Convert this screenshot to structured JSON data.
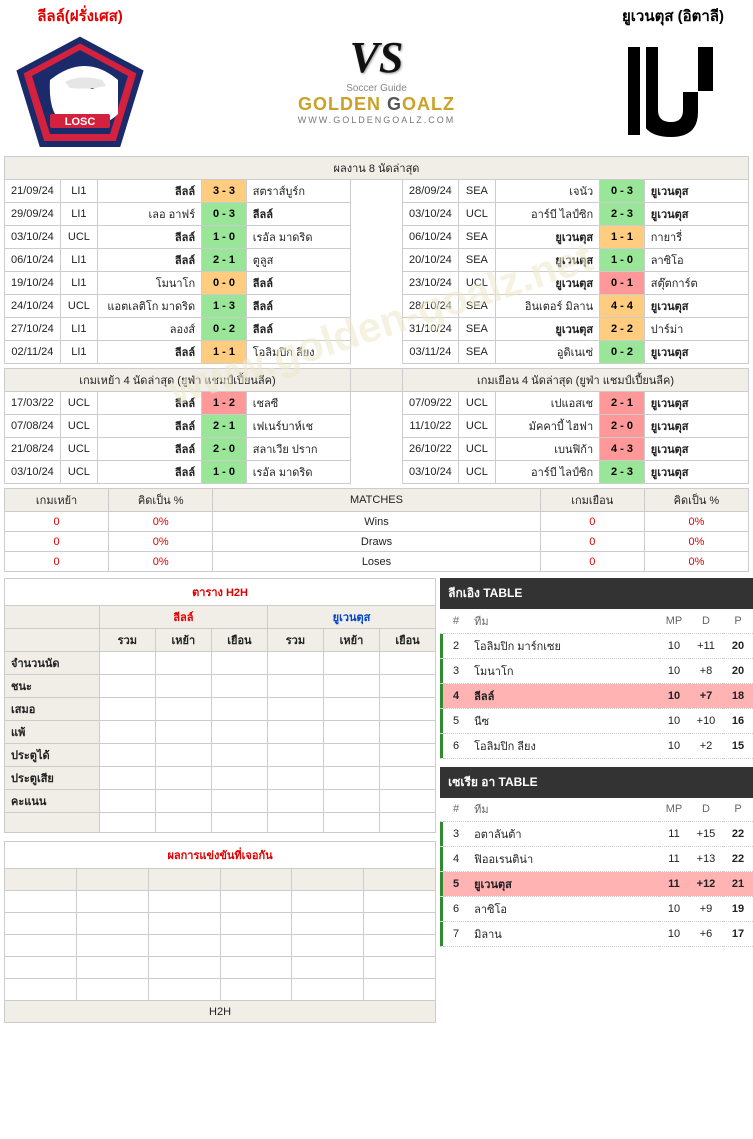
{
  "header": {
    "home_name": "ลีลล์(ฝรั่งเศส)",
    "away_name": "ยูเวนตุส (อิตาลี)",
    "vs": "VS",
    "site_brand_a": "GOLDEN",
    "site_brand_b": " G",
    "site_brand_c": "OALZ",
    "site_sub": "WWW.GOLDENGOALZ.COM",
    "soccer_guide": "Soccer Guide"
  },
  "last8": {
    "title": "ผลงาน 8 นัดล่าสุด",
    "home": [
      {
        "date": "21/09/24",
        "comp": "LI1",
        "home": "ลีลล์",
        "score": "3 - 3",
        "res": "draw",
        "away": "สตราส์บูร์ก",
        "focus": "home"
      },
      {
        "date": "29/09/24",
        "comp": "LI1",
        "home": "เลอ อาฟร์",
        "score": "0 - 3",
        "res": "win",
        "away": "ลีลล์",
        "focus": "away"
      },
      {
        "date": "03/10/24",
        "comp": "UCL",
        "home": "ลีลล์",
        "score": "1 - 0",
        "res": "win",
        "away": "เรอัล มาดริด",
        "focus": "home"
      },
      {
        "date": "06/10/24",
        "comp": "LI1",
        "home": "ลีลล์",
        "score": "2 - 1",
        "res": "win",
        "away": "ตูลูส",
        "focus": "home"
      },
      {
        "date": "19/10/24",
        "comp": "LI1",
        "home": "โมนาโก",
        "score": "0 - 0",
        "res": "draw",
        "away": "ลีลล์",
        "focus": "away"
      },
      {
        "date": "24/10/24",
        "comp": "UCL",
        "home": "แอตเลติโก มาดริด",
        "score": "1 - 3",
        "res": "win",
        "away": "ลีลล์",
        "focus": "away"
      },
      {
        "date": "27/10/24",
        "comp": "LI1",
        "home": "ลองส์",
        "score": "0 - 2",
        "res": "win",
        "away": "ลีลล์",
        "focus": "away"
      },
      {
        "date": "02/11/24",
        "comp": "LI1",
        "home": "ลีลล์",
        "score": "1 - 1",
        "res": "draw",
        "away": "โอลิมปิก ลียง",
        "focus": "home"
      }
    ],
    "away": [
      {
        "date": "28/09/24",
        "comp": "SEA",
        "home": "เจนัว",
        "score": "0 - 3",
        "res": "win",
        "away": "ยูเวนตุส",
        "focus": "away"
      },
      {
        "date": "03/10/24",
        "comp": "UCL",
        "home": "อาร์บี ไลป์ซิก",
        "score": "2 - 3",
        "res": "win",
        "away": "ยูเวนตุส",
        "focus": "away"
      },
      {
        "date": "06/10/24",
        "comp": "SEA",
        "home": "ยูเวนตุส",
        "score": "1 - 1",
        "res": "draw",
        "away": "กายารี่",
        "focus": "home"
      },
      {
        "date": "20/10/24",
        "comp": "SEA",
        "home": "ยูเวนตุส",
        "score": "1 - 0",
        "res": "win",
        "away": "ลาซิโอ",
        "focus": "home"
      },
      {
        "date": "23/10/24",
        "comp": "UCL",
        "home": "ยูเวนตุส",
        "score": "0 - 1",
        "res": "loss",
        "away": "สตุ๊ตการ์ต",
        "focus": "home"
      },
      {
        "date": "28/10/24",
        "comp": "SEA",
        "home": "อินเตอร์ มิลาน",
        "score": "4 - 4",
        "res": "draw",
        "away": "ยูเวนตุส",
        "focus": "away"
      },
      {
        "date": "31/10/24",
        "comp": "SEA",
        "home": "ยูเวนตุส",
        "score": "2 - 2",
        "res": "draw",
        "away": "ปาร์ม่า",
        "focus": "home"
      },
      {
        "date": "03/11/24",
        "comp": "SEA",
        "home": "อูดิเนเซ่",
        "score": "0 - 2",
        "res": "win",
        "away": "ยูเวนตุส",
        "focus": "away"
      }
    ]
  },
  "last4": {
    "home_title": "เกมเหย้า 4 นัดล่าสุด (ยูฟ่า แชมป์เปี้ยนลีค)",
    "away_title": "เกมเยือน 4 นัดล่าสุด (ยูฟ่า แชมป์เปี้ยนลีค)",
    "home": [
      {
        "date": "17/03/22",
        "comp": "UCL",
        "home": "ลีลล์",
        "score": "1 - 2",
        "res": "loss",
        "away": "เชลซี"
      },
      {
        "date": "07/08/24",
        "comp": "UCL",
        "home": "ลีลล์",
        "score": "2 - 1",
        "res": "win",
        "away": "เฟเนร์บาห์เช"
      },
      {
        "date": "21/08/24",
        "comp": "UCL",
        "home": "ลีลล์",
        "score": "2 - 0",
        "res": "win",
        "away": "สลาเวีย ปราก"
      },
      {
        "date": "03/10/24",
        "comp": "UCL",
        "home": "ลีลล์",
        "score": "1 - 0",
        "res": "win",
        "away": "เรอัล มาดริด"
      }
    ],
    "away": [
      {
        "date": "07/09/22",
        "comp": "UCL",
        "home": "เปแอสเช",
        "score": "2 - 1",
        "res": "loss",
        "away": "ยูเวนตุส"
      },
      {
        "date": "11/10/22",
        "comp": "UCL",
        "home": "มัคคาบี้ ไฮฟา",
        "score": "2 - 0",
        "res": "loss",
        "away": "ยูเวนตุส"
      },
      {
        "date": "26/10/22",
        "comp": "UCL",
        "home": "เบนฟิก้า",
        "score": "4 - 3",
        "res": "loss",
        "away": "ยูเวนตุส"
      },
      {
        "date": "03/10/24",
        "comp": "UCL",
        "home": "อาร์บี ไลป์ซิก",
        "score": "2 - 3",
        "res": "win",
        "away": "ยูเวนตุส"
      }
    ]
  },
  "wdl": {
    "cols": [
      "เกมเหย้า",
      "คิดเป็น %",
      "MATCHES",
      "เกมเยือน",
      "คิดเป็น %"
    ],
    "rows": [
      {
        "h": "0",
        "hp": "0%",
        "label": "Wins",
        "a": "0",
        "ap": "0%"
      },
      {
        "h": "0",
        "hp": "0%",
        "label": "Draws",
        "a": "0",
        "ap": "0%"
      },
      {
        "h": "0",
        "hp": "0%",
        "label": "Loses",
        "a": "0",
        "ap": "0%"
      }
    ]
  },
  "h2h": {
    "title": "ตาราง H2H",
    "home_team": "ลีลล์",
    "away_team": "ยูเวนตุส",
    "sub": [
      "รวม",
      "เหย้า",
      "เยือน",
      "รวม",
      "เหย้า",
      "เยือน"
    ],
    "rows": [
      "จำนวนนัด",
      "ชนะ",
      "เสมอ",
      "แพ้",
      "ประตูได้",
      "ประตูเสีย",
      "คะแนน"
    ]
  },
  "past": {
    "title": "ผลการแข่งขันที่เจอกัน",
    "note": "H2H"
  },
  "league1": {
    "title": "ลีกเอิง TABLE",
    "cols": [
      "#",
      "ทีม",
      "MP",
      "D",
      "P"
    ],
    "rows": [
      {
        "pos": "2",
        "team": "โอลิมปิก มาร์กเซย",
        "mp": "10",
        "d": "+11",
        "p": "20",
        "hl": false
      },
      {
        "pos": "3",
        "team": "โมนาโก",
        "mp": "10",
        "d": "+8",
        "p": "20",
        "hl": false
      },
      {
        "pos": "4",
        "team": "ลีลล์",
        "mp": "10",
        "d": "+7",
        "p": "18",
        "hl": true
      },
      {
        "pos": "5",
        "team": "นีซ",
        "mp": "10",
        "d": "+10",
        "p": "16",
        "hl": false
      },
      {
        "pos": "6",
        "team": "โอลิมปิก ลียง",
        "mp": "10",
        "d": "+2",
        "p": "15",
        "hl": false
      }
    ]
  },
  "league2": {
    "title": "เซเรีย อา TABLE",
    "cols": [
      "#",
      "ทีม",
      "MP",
      "D",
      "P"
    ],
    "rows": [
      {
        "pos": "3",
        "team": "อตาลันต้า",
        "mp": "11",
        "d": "+15",
        "p": "22",
        "hl": false
      },
      {
        "pos": "4",
        "team": "ฟิออเรนติน่า",
        "mp": "11",
        "d": "+13",
        "p": "22",
        "hl": false
      },
      {
        "pos": "5",
        "team": "ยูเวนตุส",
        "mp": "11",
        "d": "+12",
        "p": "21",
        "hl": true
      },
      {
        "pos": "6",
        "team": "ลาซิโอ",
        "mp": "10",
        "d": "+9",
        "p": "19",
        "hl": false
      },
      {
        "pos": "7",
        "team": "มิลาน",
        "mp": "10",
        "d": "+6",
        "p": "17",
        "hl": false
      }
    ]
  },
  "watermark": "www.golden-goalz.net"
}
